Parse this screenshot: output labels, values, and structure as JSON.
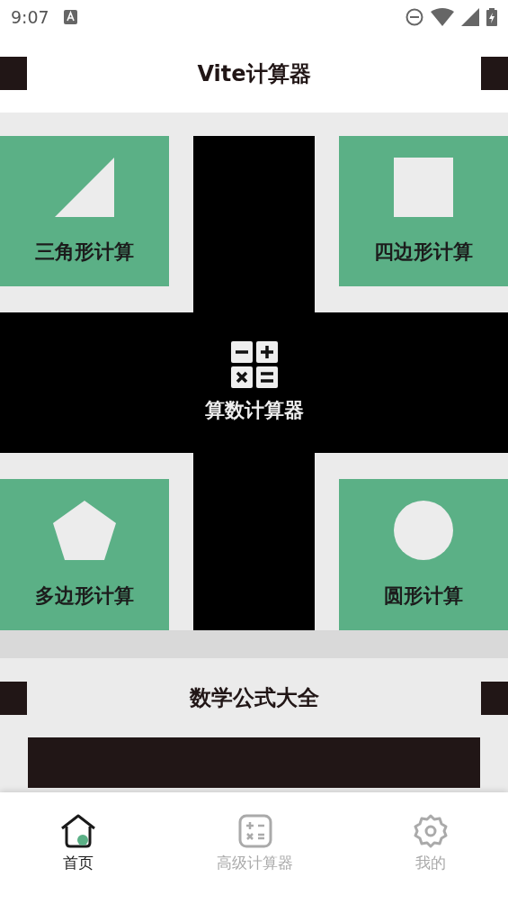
{
  "status_bar": {
    "time": "9:07"
  },
  "header": {
    "title": "Vite计算器"
  },
  "tiles": [
    {
      "label": "三角形计算",
      "kind": "triangle"
    },
    {
      "label": "四边形计算",
      "kind": "square"
    },
    {
      "label": "多边形计算",
      "kind": "pentagon"
    },
    {
      "label": "圆形计算",
      "kind": "circle"
    }
  ],
  "center": {
    "label": "算数计算器"
  },
  "formulas": {
    "title": "数学公式大全"
  },
  "nav": [
    {
      "label": "首页",
      "kind": "home",
      "selected": true
    },
    {
      "label": "高级计算器",
      "kind": "calculator",
      "selected": false
    },
    {
      "label": "我的",
      "kind": "settings",
      "selected": false
    }
  ]
}
